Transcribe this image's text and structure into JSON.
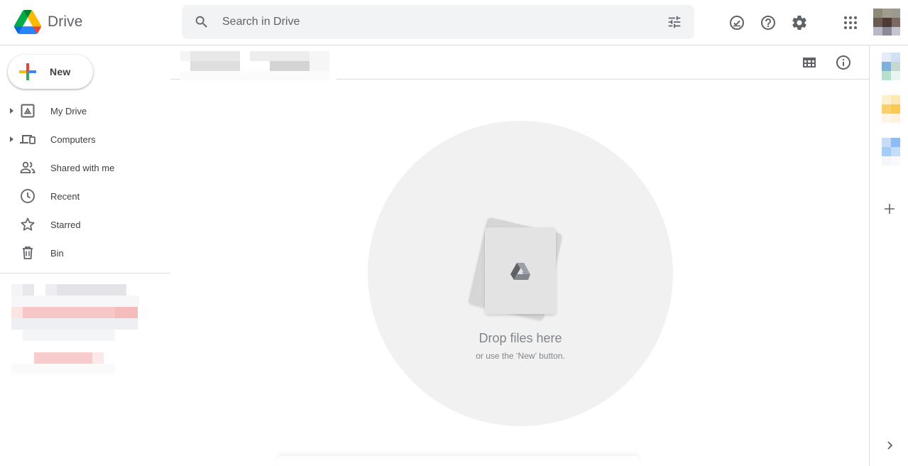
{
  "header": {
    "app_name": "Drive",
    "search_placeholder": "Search in Drive",
    "icons": [
      "search-icon",
      "tune-icon",
      "ready-offline-icon",
      "help-icon",
      "settings-icon",
      "apps-grid-icon"
    ]
  },
  "sidebar": {
    "new_label": "New",
    "items": [
      {
        "label": "My Drive",
        "icon": "my-drive-icon",
        "expandable": true
      },
      {
        "label": "Computers",
        "icon": "computers-icon",
        "expandable": true
      },
      {
        "label": "Shared with me",
        "icon": "shared-icon",
        "expandable": false
      },
      {
        "label": "Recent",
        "icon": "clock-icon",
        "expandable": false
      },
      {
        "label": "Starred",
        "icon": "star-icon",
        "expandable": false
      },
      {
        "label": "Bin",
        "icon": "trash-icon",
        "expandable": false
      }
    ]
  },
  "main": {
    "drop_title": "Drop files here",
    "drop_subtitle": "or use the ‘New’ button."
  },
  "colors": {
    "drive_green": "#0f9d58",
    "drive_yellow": "#f4b400",
    "drive_blue": "#4285f4",
    "drive_red": "#db4437",
    "icon_gray": "#5f6368",
    "divider": "#dadce0"
  }
}
